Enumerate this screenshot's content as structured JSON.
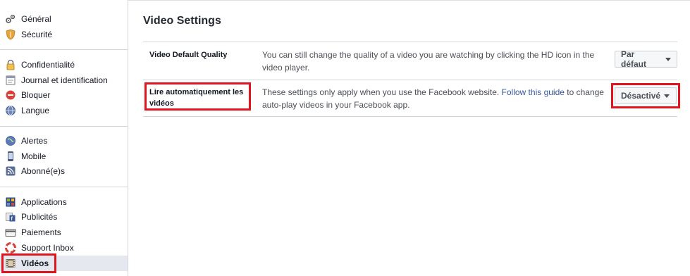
{
  "sidebar": {
    "groups": [
      {
        "items": [
          {
            "label": "Général",
            "icon": "gears-icon"
          },
          {
            "label": "Sécurité",
            "icon": "shield-icon"
          }
        ]
      },
      {
        "items": [
          {
            "label": "Confidentialité",
            "icon": "lock-icon"
          },
          {
            "label": "Journal et identification",
            "icon": "timeline-icon"
          },
          {
            "label": "Bloquer",
            "icon": "block-icon"
          },
          {
            "label": "Langue",
            "icon": "globe-icon"
          }
        ]
      },
      {
        "items": [
          {
            "label": "Alertes",
            "icon": "notification-globe-icon"
          },
          {
            "label": "Mobile",
            "icon": "mobile-icon"
          },
          {
            "label": "Abonné(e)s",
            "icon": "rss-icon"
          }
        ]
      },
      {
        "items": [
          {
            "label": "Applications",
            "icon": "apps-icon"
          },
          {
            "label": "Publicités",
            "icon": "ads-icon"
          },
          {
            "label": "Paiements",
            "icon": "card-icon"
          },
          {
            "label": "Support Inbox",
            "icon": "lifebuoy-icon"
          },
          {
            "label": "Vidéos",
            "icon": "film-icon",
            "active": true
          }
        ]
      }
    ]
  },
  "main": {
    "title": "Video Settings",
    "rows": [
      {
        "label": "Video Default Quality",
        "description": "You can still change the quality of a video you are watching by clicking the HD icon in the video player.",
        "dropdown": "Par défaut"
      },
      {
        "label": "Lire automatiquement les vidéos",
        "description_before": "These settings only apply when you use the Facebook website. ",
        "link": "Follow this guide",
        "description_after": " to change auto-play videos in your Facebook app.",
        "dropdown": "Désactivé"
      }
    ]
  },
  "colors": {
    "highlight": "#e0161f",
    "link": "#365899",
    "active_bg": "#e5e8ee"
  }
}
